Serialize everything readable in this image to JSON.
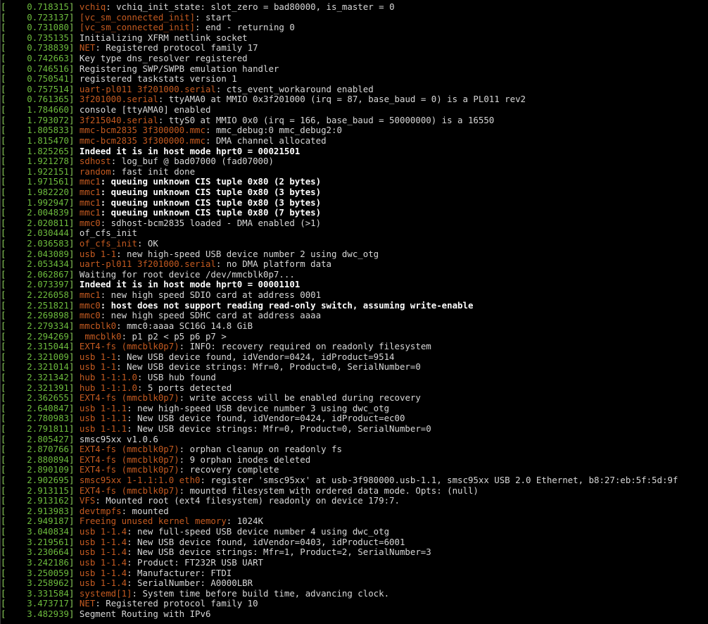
{
  "colors": {
    "background": "#000000",
    "timestamp": "#6dbb3d",
    "source": "#c45a20",
    "message": "#d8d8d8",
    "bold_message": "#ffffff"
  },
  "lines": [
    {
      "ts": "0.718315",
      "src": "vchiq",
      "msg": ": vchiq_init_state: slot_zero = bad80000, is_master = 0",
      "bold": false
    },
    {
      "ts": "0.723137",
      "src": "[vc_sm_connected_init]",
      "msg": ": start",
      "bold": false
    },
    {
      "ts": "0.731080",
      "src": "[vc_sm_connected_init]",
      "msg": ": end - returning 0",
      "bold": false
    },
    {
      "ts": "0.735135",
      "src": "",
      "msg": "Initializing XFRM netlink socket",
      "bold": false
    },
    {
      "ts": "0.738839",
      "src": "NET",
      "msg": ": Registered protocol family 17",
      "bold": false
    },
    {
      "ts": "0.742663",
      "src": "",
      "msg": "Key type dns_resolver registered",
      "bold": false
    },
    {
      "ts": "0.746516",
      "src": "",
      "msg": "Registering SWP/SWPB emulation handler",
      "bold": false
    },
    {
      "ts": "0.750541",
      "src": "",
      "msg": "registered taskstats version 1",
      "bold": false
    },
    {
      "ts": "0.757514",
      "src": "uart-pl011 3f201000.serial",
      "msg": ": cts_event_workaround enabled",
      "bold": false
    },
    {
      "ts": "0.761365",
      "src": "3f201000.serial",
      "msg": ": ttyAMA0 at MMIO 0x3f201000 (irq = 87, base_baud = 0) is a PL011 rev2",
      "bold": false
    },
    {
      "ts": "1.784660",
      "src": "",
      "msg": "console [ttyAMA0] enabled",
      "bold": false
    },
    {
      "ts": "1.793072",
      "src": "3f215040.serial",
      "msg": ": ttyS0 at MMIO 0x0 (irq = 166, base_baud = 50000000) is a 16550",
      "bold": false
    },
    {
      "ts": "1.805833",
      "src": "mmc-bcm2835 3f300000.mmc",
      "msg": ": mmc_debug:0 mmc_debug2:0",
      "bold": false
    },
    {
      "ts": "1.815470",
      "src": "mmc-bcm2835 3f300000.mmc",
      "msg": ": DMA channel allocated",
      "bold": false
    },
    {
      "ts": "1.825265",
      "src": "",
      "msg": "Indeed it is in host mode hprt0 = 00021501",
      "bold": true
    },
    {
      "ts": "1.921278",
      "src": "sdhost",
      "msg": ": log_buf @ bad07000 (fad07000)",
      "bold": false
    },
    {
      "ts": "1.922151",
      "src": "random",
      "msg": ": fast init done",
      "bold": false
    },
    {
      "ts": "1.971561",
      "src": "mmc1",
      "msg": ": queuing unknown CIS tuple 0x80 (2 bytes)",
      "bold": true
    },
    {
      "ts": "1.982220",
      "src": "mmc1",
      "msg": ": queuing unknown CIS tuple 0x80 (3 bytes)",
      "bold": true
    },
    {
      "ts": "1.992947",
      "src": "mmc1",
      "msg": ": queuing unknown CIS tuple 0x80 (3 bytes)",
      "bold": true
    },
    {
      "ts": "2.004839",
      "src": "mmc1",
      "msg": ": queuing unknown CIS tuple 0x80 (7 bytes)",
      "bold": true
    },
    {
      "ts": "2.020811",
      "src": "mmc0",
      "msg": ": sdhost-bcm2835 loaded - DMA enabled (>1)",
      "bold": false
    },
    {
      "ts": "2.030444",
      "src": "",
      "msg": "of_cfs_init",
      "bold": false
    },
    {
      "ts": "2.036583",
      "src": "of_cfs_init",
      "msg": ": OK",
      "bold": false
    },
    {
      "ts": "2.043089",
      "src": "usb 1-1",
      "msg": ": new high-speed USB device number 2 using dwc_otg",
      "bold": false
    },
    {
      "ts": "2.053434",
      "src": "uart-pl011 3f201000.serial",
      "msg": ": no DMA platform data",
      "bold": false
    },
    {
      "ts": "2.062867",
      "src": "",
      "msg": "Waiting for root device /dev/mmcblk0p7...",
      "bold": false
    },
    {
      "ts": "2.073397",
      "src": "",
      "msg": "Indeed it is in host mode hprt0 = 00001101",
      "bold": true
    },
    {
      "ts": "2.226058",
      "src": "mmc1",
      "msg": ": new high speed SDIO card at address 0001",
      "bold": false
    },
    {
      "ts": "2.251821",
      "src": "mmc0",
      "msg": ": host does not support reading read-only switch, assuming write-enable",
      "bold": true
    },
    {
      "ts": "2.269898",
      "src": "mmc0",
      "msg": ": new high speed SDHC card at address aaaa",
      "bold": false
    },
    {
      "ts": "2.279334",
      "src": "mmcblk0",
      "msg": ": mmc0:aaaa SC16G 14.8 GiB",
      "bold": false
    },
    {
      "ts": "2.294269",
      "src": " mmcblk0",
      "msg": ": p1 p2 < p5 p6 p7 >",
      "bold": false
    },
    {
      "ts": "2.315044",
      "src": "EXT4-fs (mmcblk0p7)",
      "msg": ": INFO: recovery required on readonly filesystem",
      "bold": false
    },
    {
      "ts": "2.321009",
      "src": "usb 1-1",
      "msg": ": New USB device found, idVendor=0424, idProduct=9514",
      "bold": false
    },
    {
      "ts": "2.321014",
      "src": "usb 1-1",
      "msg": ": New USB device strings: Mfr=0, Product=0, SerialNumber=0",
      "bold": false
    },
    {
      "ts": "2.321342",
      "src": "hub 1-1:1.0",
      "msg": ": USB hub found",
      "bold": false
    },
    {
      "ts": "2.321391",
      "src": "hub 1-1:1.0",
      "msg": ": 5 ports detected",
      "bold": false
    },
    {
      "ts": "2.362655",
      "src": "EXT4-fs (mmcblk0p7)",
      "msg": ": write access will be enabled during recovery",
      "bold": false
    },
    {
      "ts": "2.640847",
      "src": "usb 1-1.1",
      "msg": ": new high-speed USB device number 3 using dwc_otg",
      "bold": false
    },
    {
      "ts": "2.780983",
      "src": "usb 1-1.1",
      "msg": ": New USB device found, idVendor=0424, idProduct=ec00",
      "bold": false
    },
    {
      "ts": "2.791811",
      "src": "usb 1-1.1",
      "msg": ": New USB device strings: Mfr=0, Product=0, SerialNumber=0",
      "bold": false
    },
    {
      "ts": "2.805427",
      "src": "",
      "msg": "smsc95xx v1.0.6",
      "bold": false
    },
    {
      "ts": "2.870766",
      "src": "EXT4-fs (mmcblk0p7)",
      "msg": ": orphan cleanup on readonly fs",
      "bold": false
    },
    {
      "ts": "2.880894",
      "src": "EXT4-fs (mmcblk0p7)",
      "msg": ": 9 orphan inodes deleted",
      "bold": false
    },
    {
      "ts": "2.890109",
      "src": "EXT4-fs (mmcblk0p7)",
      "msg": ": recovery complete",
      "bold": false
    },
    {
      "ts": "2.902695",
      "src": "smsc95xx 1-1.1:1.0 eth0",
      "msg": ": register 'smsc95xx' at usb-3f980000.usb-1.1, smsc95xx USB 2.0 Ethernet, b8:27:eb:5f:5d:9f",
      "bold": false
    },
    {
      "ts": "2.913115",
      "src": "EXT4-fs (mmcblk0p7)",
      "msg": ": mounted filesystem with ordered data mode. Opts: (null)",
      "bold": false
    },
    {
      "ts": "2.913162",
      "src": "VFS",
      "msg": ": Mounted root (ext4 filesystem) readonly on device 179:7.",
      "bold": false
    },
    {
      "ts": "2.913983",
      "src": "devtmpfs",
      "msg": ": mounted",
      "bold": false
    },
    {
      "ts": "2.949187",
      "src": "Freeing unused kernel memory",
      "msg": ": 1024K",
      "bold": false
    },
    {
      "ts": "3.040834",
      "src": "usb 1-1.4",
      "msg": ": new full-speed USB device number 4 using dwc_otg",
      "bold": false
    },
    {
      "ts": "3.219561",
      "src": "usb 1-1.4",
      "msg": ": New USB device found, idVendor=0403, idProduct=6001",
      "bold": false
    },
    {
      "ts": "3.230664",
      "src": "usb 1-1.4",
      "msg": ": New USB device strings: Mfr=1, Product=2, SerialNumber=3",
      "bold": false
    },
    {
      "ts": "3.242186",
      "src": "usb 1-1.4",
      "msg": ": Product: FT232R USB UART",
      "bold": false
    },
    {
      "ts": "3.250059",
      "src": "usb 1-1.4",
      "msg": ": Manufacturer: FTDI",
      "bold": false
    },
    {
      "ts": "3.258962",
      "src": "usb 1-1.4",
      "msg": ": SerialNumber: A0000LBR",
      "bold": false
    },
    {
      "ts": "3.331584",
      "src": "systemd[1]",
      "msg": ": System time before build time, advancing clock.",
      "bold": false
    },
    {
      "ts": "3.473717",
      "src": "NET",
      "msg": ": Registered protocol family 10",
      "bold": false
    },
    {
      "ts": "3.482939",
      "src": "",
      "msg": "Segment Routing with IPv6",
      "bold": false
    }
  ]
}
